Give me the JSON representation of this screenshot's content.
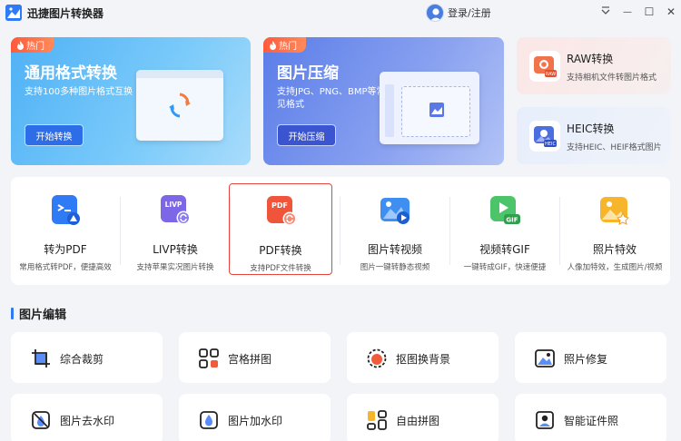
{
  "app": {
    "title": "迅捷图片转换器"
  },
  "titlebar": {
    "login_label": "登录/注册",
    "min_glyph": "—",
    "max_glyph": "☐",
    "close_glyph": "✕"
  },
  "banners": [
    {
      "badge": "热门",
      "title": "通用格式转换",
      "desc": "支持100多种图片格式互换",
      "button": "开始转换"
    },
    {
      "badge": "热门",
      "title": "图片压缩",
      "desc": "支持JPG、PNG、BMP等常见格式",
      "button": "开始压缩"
    }
  ],
  "side_cards": [
    {
      "title": "RAW转换",
      "desc": "支持相机文件转图片格式",
      "icon_text": "RAW"
    },
    {
      "title": "HEIC转换",
      "desc": "支持HEIC、HEIF格式图片",
      "icon_text": "HEIC"
    }
  ],
  "tools": [
    {
      "label": "转为PDF",
      "desc": "常用格式转PDF，便捷高效"
    },
    {
      "label": "LIVP转换",
      "desc": "支持苹果实况图片转换",
      "icon_text": "LIVP"
    },
    {
      "label": "PDF转换",
      "desc": "支持PDF文件转换",
      "icon_text": "PDF"
    },
    {
      "label": "图片转视频",
      "desc": "图片一键转静态视频"
    },
    {
      "label": "视频转GIF",
      "desc": "一键转成GIF，快速便捷",
      "icon_text": "GIF"
    },
    {
      "label": "照片特效",
      "desc": "人像加特效，生成图片/视频"
    }
  ],
  "section": {
    "title": "图片编辑"
  },
  "edit_tools": [
    {
      "label": "综合裁剪"
    },
    {
      "label": "宫格拼图"
    },
    {
      "label": "抠图换背景"
    },
    {
      "label": "照片修复"
    },
    {
      "label": "图片去水印"
    },
    {
      "label": "图片加水印"
    },
    {
      "label": "自由拼图"
    },
    {
      "label": "智能证件照"
    }
  ],
  "colors": {
    "accent": "#2f7bf6",
    "hot": "#ff5a3c",
    "selected_border": "#e2463c"
  }
}
